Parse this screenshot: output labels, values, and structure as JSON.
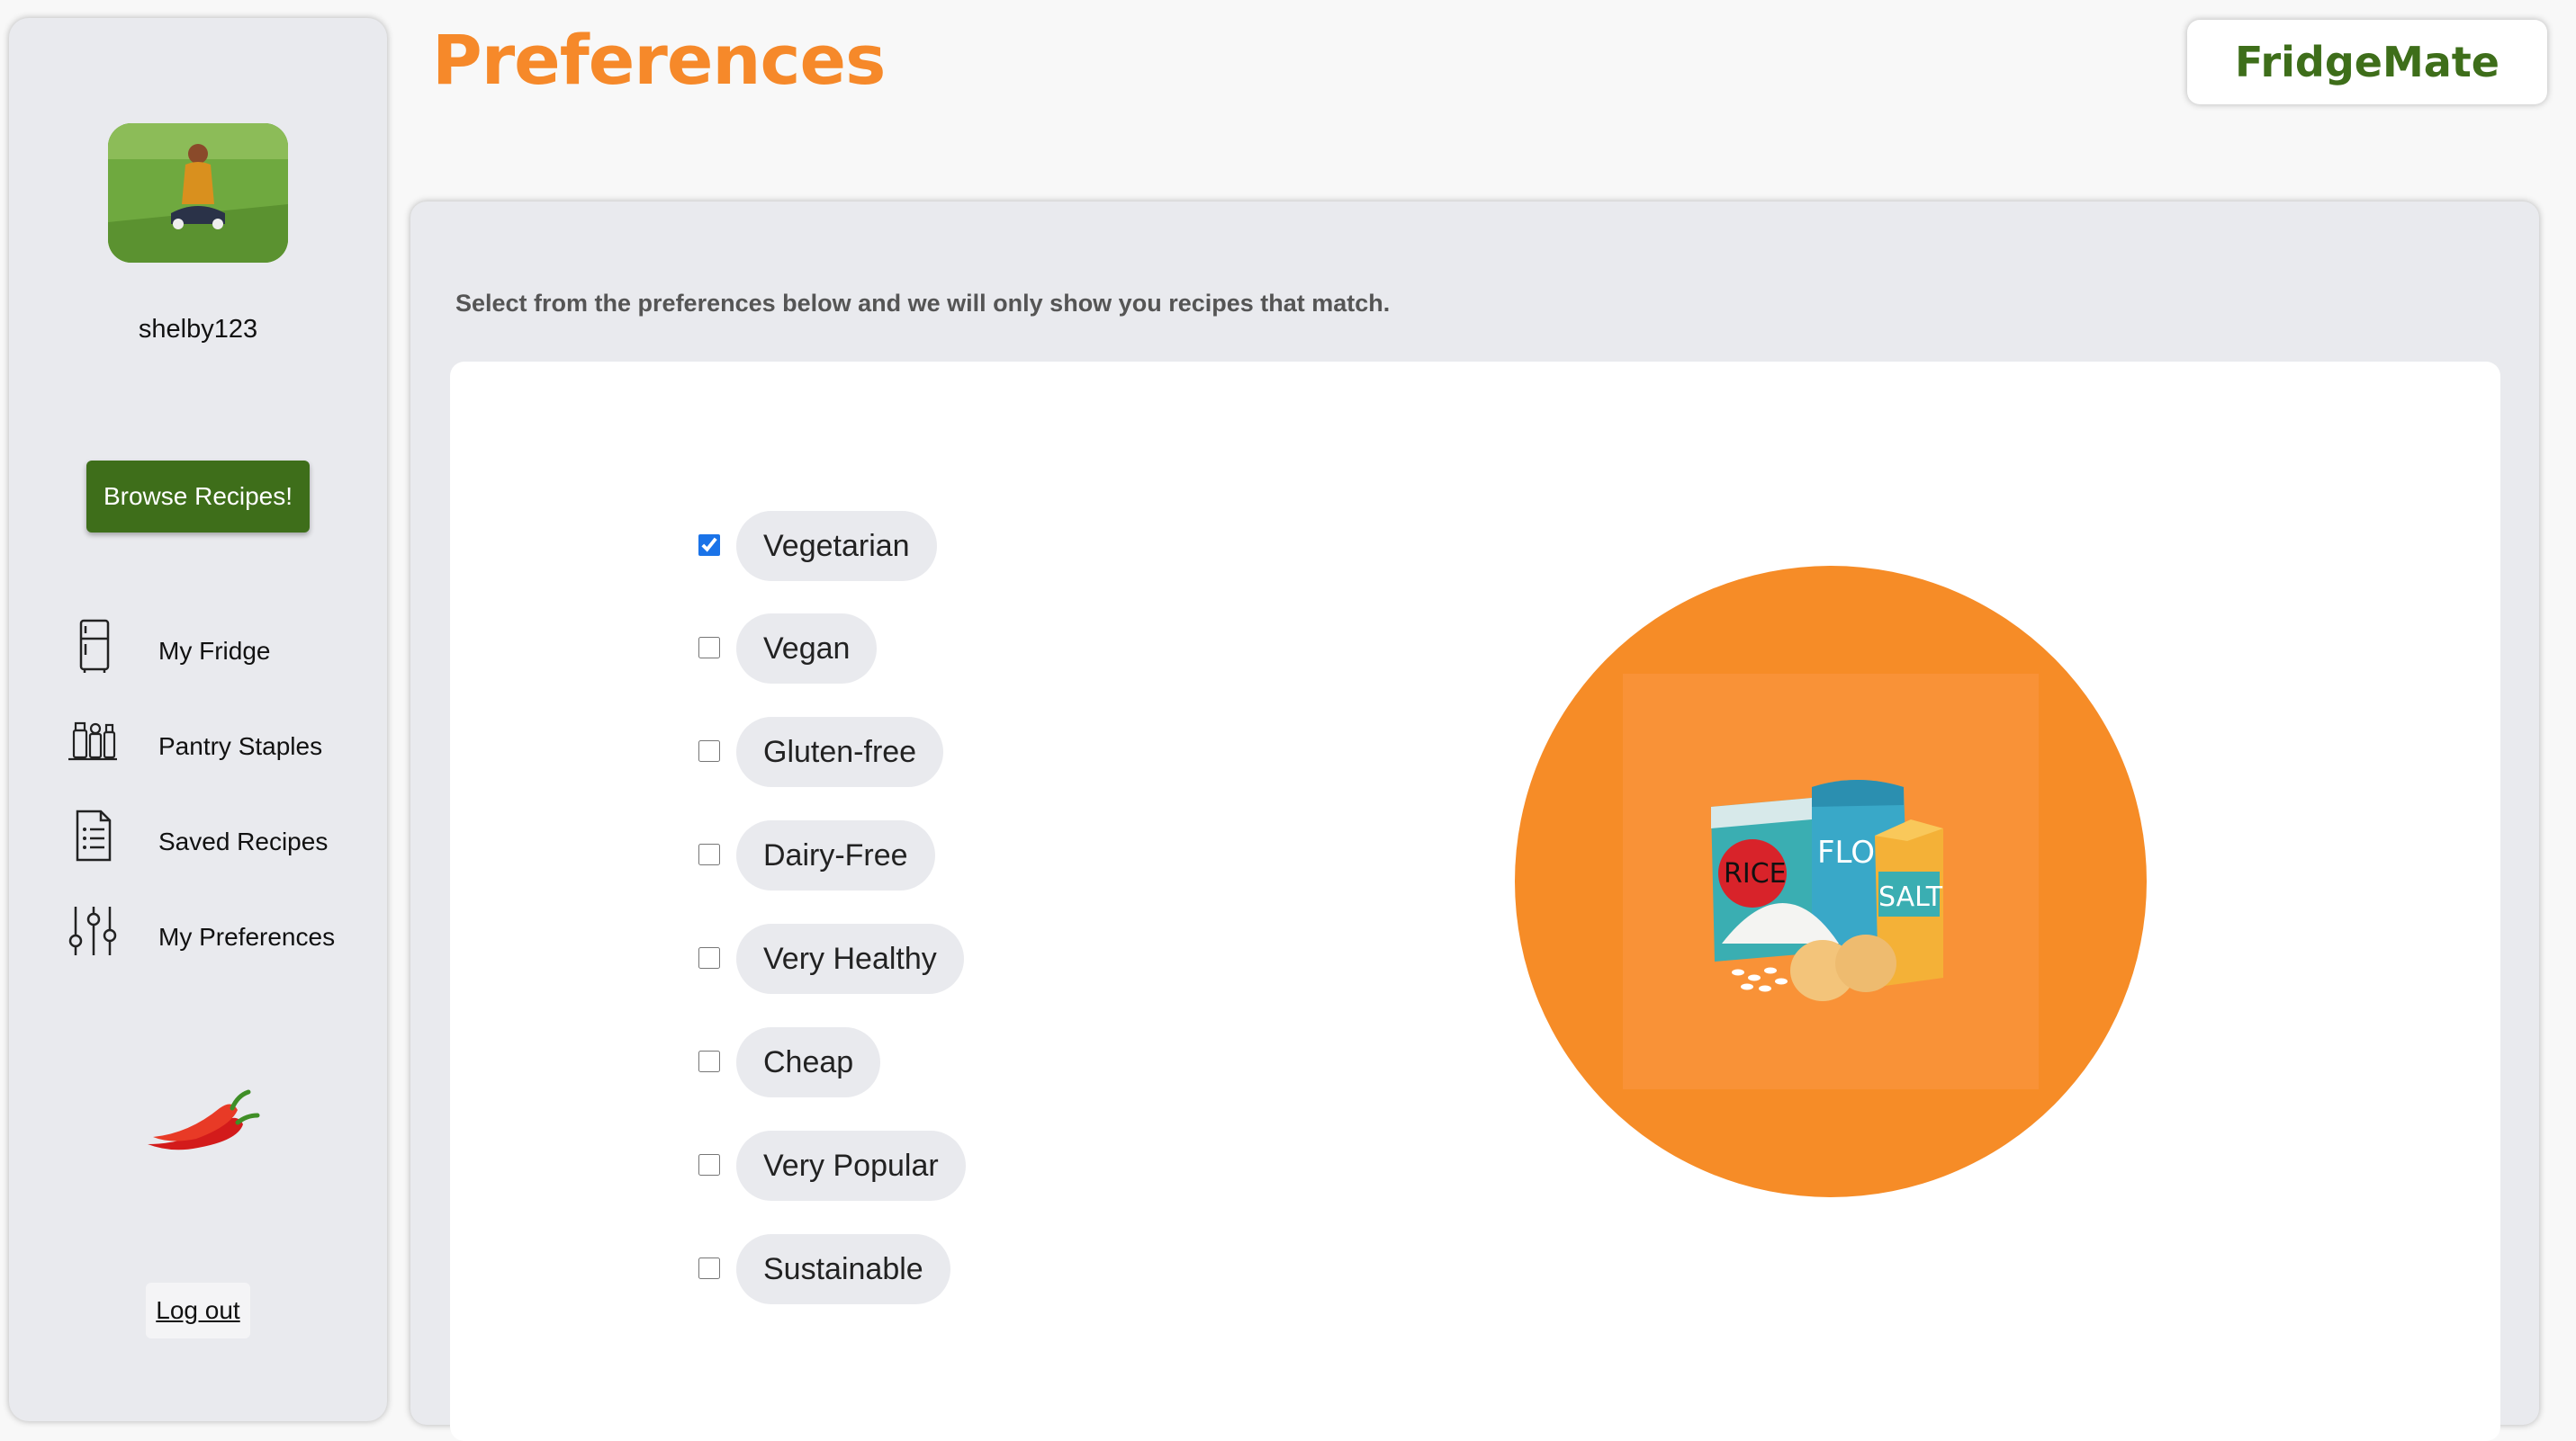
{
  "sidebar": {
    "username": "shelby123",
    "browse_button": "Browse Recipes!",
    "nav": [
      {
        "label": "My Fridge",
        "icon": "fridge-icon"
      },
      {
        "label": "Pantry Staples",
        "icon": "spice-jars-icon"
      },
      {
        "label": "Saved Recipes",
        "icon": "document-list-icon"
      },
      {
        "label": "My Preferences",
        "icon": "sliders-icon"
      }
    ],
    "logout": "Log out"
  },
  "header": {
    "title": "Preferences",
    "brand": "FridgeMate"
  },
  "main": {
    "intro": "Select from the preferences below and we will only show you recipes that match.",
    "preferences": [
      {
        "label": "Vegetarian",
        "checked": true
      },
      {
        "label": "Vegan",
        "checked": false
      },
      {
        "label": "Gluten-free",
        "checked": false
      },
      {
        "label": "Dairy-Free",
        "checked": false
      },
      {
        "label": "Very Healthy",
        "checked": false
      },
      {
        "label": "Cheap",
        "checked": false
      },
      {
        "label": "Very Popular",
        "checked": false
      },
      {
        "label": "Sustainable",
        "checked": false
      }
    ],
    "illustration_labels": {
      "rice": "RICE",
      "flour": "FLOUR",
      "salt": "SALT"
    }
  },
  "colors": {
    "accent_orange": "#f6892a",
    "brand_green": "#3e6e1a",
    "panel_gray": "#e9eaee",
    "checkbox_blue": "#1a73e8"
  }
}
